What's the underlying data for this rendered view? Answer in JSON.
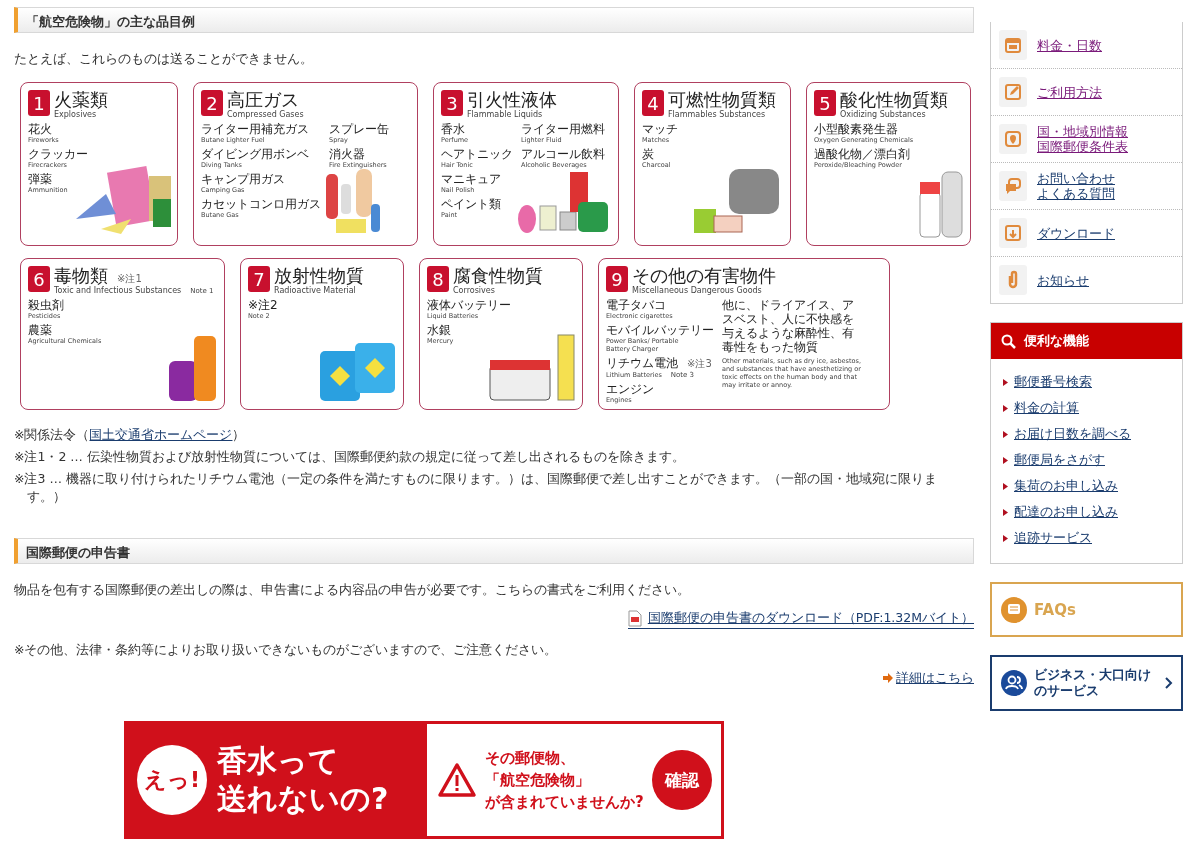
{
  "section_1": {
    "heading": "「航空危険物」の主な品目例",
    "intro": "たとえば、これらのものは送ることができません。",
    "card_rows": [
      [
        {
          "number": "1",
          "title": "火薬類",
          "subtitle": "Explosives",
          "columns": [
            [
              {
                "jp": "花火",
                "en": "Fireworks"
              },
              {
                "jp": "クラッカー",
                "en": "Firecrackers"
              },
              {
                "jp": "弾薬",
                "en": "Ammunition"
              }
            ]
          ]
        },
        {
          "number": "2",
          "title": "高圧ガス",
          "subtitle": "Compressed Gases",
          "columns": [
            [
              {
                "jp": "ライター用補充ガス",
                "en": "Butane Lighter Fuel"
              },
              {
                "jp": "ダイビング用ボンベ",
                "en": "Diving Tanks"
              },
              {
                "jp": "キャンプ用ガス",
                "en": "Camping Gas"
              },
              {
                "jp": "カセットコンロ用ガス",
                "en": "Butane Gas"
              }
            ],
            [
              {
                "jp": "スプレー缶",
                "en": "Spray"
              },
              {
                "jp": "消火器",
                "en": "Fire Extinguishers"
              }
            ]
          ]
        },
        {
          "number": "3",
          "title": "引火性液体",
          "subtitle": "Flammable Liquids",
          "columns": [
            [
              {
                "jp": "香水",
                "en": "Perfume"
              },
              {
                "jp": "ヘアトニック",
                "en": "Hair Tonic"
              },
              {
                "jp": "マニキュア",
                "en": "Nail Polish"
              },
              {
                "jp": "ペイント類",
                "en": "Paint"
              }
            ],
            [
              {
                "jp": "ライター用燃料",
                "en": "Lighter Fluid"
              },
              {
                "jp": "アルコール飲料",
                "en": "Alcoholic Beverages"
              }
            ]
          ]
        },
        {
          "number": "4",
          "title": "可燃性物質類",
          "subtitle": "Flammables Substances",
          "columns": [
            [
              {
                "jp": "マッチ",
                "en": "Matches"
              },
              {
                "jp": "炭",
                "en": "Charcoal"
              }
            ]
          ]
        },
        {
          "number": "5",
          "title": "酸化性物質類",
          "subtitle": "Oxidizing Substances",
          "columns": [
            [
              {
                "jp": "小型酸素発生器",
                "en": "Oxygen Generating Chemicals"
              },
              {
                "jp": "過酸化物／漂白剤",
                "en": "Peroxide/Bleaching Powder"
              }
            ]
          ]
        }
      ],
      [
        {
          "number": "6",
          "title": "毒物類",
          "title_note": "※注1",
          "subtitle": "Toxic and Infectious Substances",
          "subtitle_note": "Note 1",
          "columns": [
            [
              {
                "jp": "殺虫剤",
                "en": "Pesticides"
              },
              {
                "jp": "農薬",
                "en": "Agricultural Chemicals"
              }
            ]
          ]
        },
        {
          "number": "7",
          "title": "放射性物質",
          "subtitle": "Radioactive Material",
          "columns": [
            [
              {
                "jp": "※注2",
                "en": "Note 2"
              }
            ]
          ]
        },
        {
          "number": "8",
          "title": "腐食性物質",
          "subtitle": "Corrosives",
          "columns": [
            [
              {
                "jp": "液体バッテリー",
                "en": "Liquid Batteries"
              },
              {
                "jp": "水銀",
                "en": "Mercury"
              }
            ]
          ]
        },
        {
          "number": "9",
          "title": "その他の有害物件",
          "subtitle": "Miscellaneous Dangerous Goods",
          "columns": [
            [
              {
                "jp": "電子タバコ",
                "en": "Electronic cigarettes"
              },
              {
                "jp": "モバイルバッテリー",
                "en": "Power Banks/ Portable Battery Charger"
              },
              {
                "jp": "リチウム電池",
                "jp_note": "※注3",
                "en": "Lithium Batteries",
                "en_note": "Note 3"
              },
              {
                "jp": "エンジン",
                "en": "Engines"
              }
            ]
          ],
          "remark": {
            "jp": "他に、ドライアイス、アスベスト、人に不快感を与えるような麻酔性、有毒性をもった物質",
            "en": "Other materials, such as dry ice, asbestos, and substances that have anesthetizing or toxic effects on the human body and that may irritate or annoy."
          }
        }
      ]
    ],
    "notes": [
      {
        "prefix": "※関係法令（",
        "link": "国土交通省ホームページ",
        "suffix": "）"
      },
      {
        "prefix": "※注1・2 … 伝染性物質および放射性物質については、国際郵便約款の規定に従って差し出されるものを除きます。"
      },
      {
        "prefix": "※注3 … 機器に取り付けられたリチウム電池（一定の条件を満たすものに限ります。）は、国際郵便で差し出すことができます。（一部の国・地域宛に限ります。）"
      }
    ]
  },
  "section_2": {
    "heading": "国際郵便の申告書",
    "text": "物品を包有する国際郵便の差出しの際は、申告書による内容品の申告が必要です。こちらの書式をご利用ください。",
    "download_link": "国際郵便の申告書のダウンロード（PDF:1.32Mバイト）",
    "caution": "※その他、法律・条約等によりお取り扱いできないものがございますので、ご注意ください。",
    "details_link": "詳細はこちら"
  },
  "banner": {
    "badge": "えっ!",
    "headline_lines": [
      "香水って",
      "送れないの?"
    ],
    "message_lines": [
      "その郵便物、",
      "「航空危険物」",
      "が含まれていませんか?"
    ],
    "button": "確認"
  },
  "sidebar": {
    "menu": [
      {
        "kind": "calendar",
        "lines": [
          "料金・日数"
        ],
        "visited": true
      },
      {
        "kind": "edit",
        "lines": [
          "ご利用方法"
        ],
        "visited": true
      },
      {
        "kind": "pin",
        "lines": [
          "国・地域別情報",
          "国際郵便条件表"
        ],
        "visited": true
      },
      {
        "kind": "chat",
        "lines": [
          "お問い合わせ",
          "よくある質問"
        ],
        "visited": false
      },
      {
        "kind": "download",
        "lines": [
          "ダウンロード"
        ],
        "visited": false
      },
      {
        "kind": "clip",
        "lines": [
          "お知らせ"
        ],
        "visited": false
      }
    ],
    "tools": {
      "title": "便利な機能",
      "links": [
        "郵便番号検索",
        "料金の計算",
        "お届け日数を調べる",
        "郵便局をさがす",
        "集荷のお申し込み",
        "配達のお申し込み",
        "追跡サービス"
      ]
    },
    "faq": "FAQs",
    "business_lines": [
      "ビジネス・大口向け",
      "のサービス"
    ]
  }
}
